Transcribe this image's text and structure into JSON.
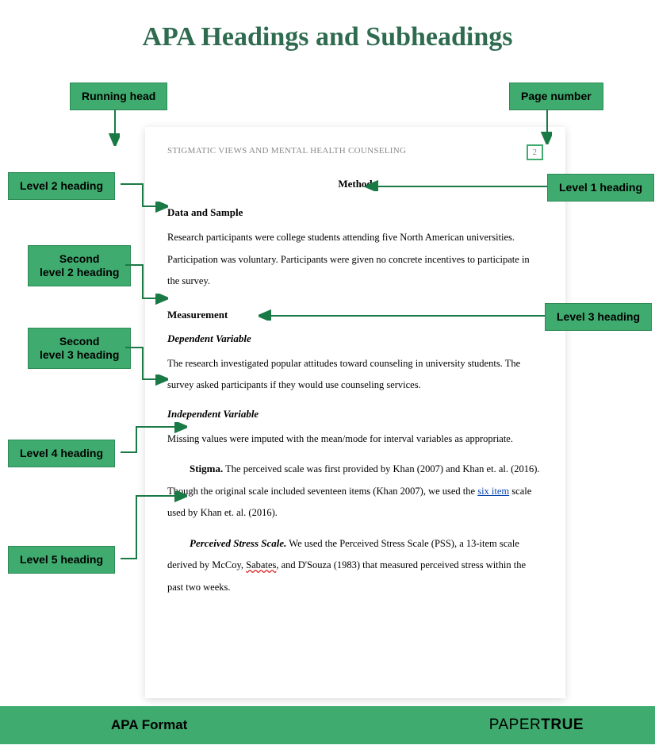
{
  "title": "APA Headings and Subheadings",
  "labels": {
    "running_head": "Running head",
    "page_number": "Page number",
    "level1": "Level 1 heading",
    "level2": "Level 2 heading",
    "second_level2": "Second\nlevel 2 heading",
    "level3": "Level 3 heading",
    "second_level3": "Second\nlevel 3 heading",
    "level4": "Level 4 heading",
    "level5": "Level 5 heading"
  },
  "doc": {
    "running_head": "STIGMATIC VIEWS AND MENTAL HEALTH COUNSELING",
    "page_number": "2",
    "level1": "Method",
    "level2a": "Data and Sample",
    "body1": "Research participants were college students attending five North American universities. Participation was voluntary. Participants were given no concrete incentives to participate in the survey.",
    "level2b": "Measurement",
    "level3a": "Dependent Variable",
    "body2": "The research investigated popular attitudes toward counseling in university students. The survey asked participants if they would use counseling services.",
    "level3b": "Independent Variable",
    "body3": "Missing values were imputed with the mean/mode for interval variables as appropriate.",
    "level4_label": "Stigma.",
    "body4a": " The perceived scale was first provided by Khan (2007) and Khan et. al. (2016). Though the original scale included seventeen items (Khan 2007), we used the ",
    "link4": "six item",
    "body4b": " scale used by Khan et. al. (2016).",
    "level5_label": "Perceived Stress Scale.",
    "body5a": " We used the Perceived Stress Scale (PSS), a 13-item scale derived by McCoy, ",
    "wavy5": "Sabates",
    "body5b": ", and D'Souza (1983) that measured perceived stress within the past two weeks."
  },
  "footer": {
    "label": "APA Format",
    "brand_thin": "PAPER",
    "brand_bold": "TRUE"
  }
}
